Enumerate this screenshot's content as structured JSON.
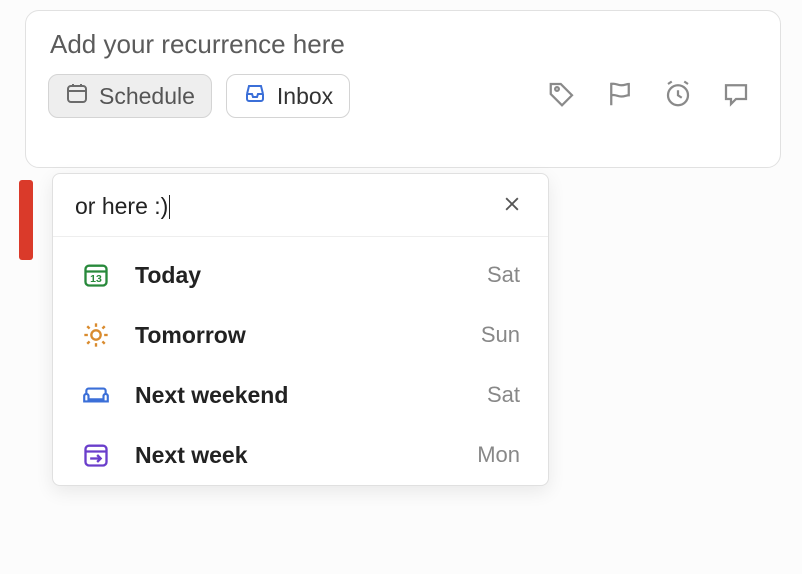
{
  "task": {
    "title_placeholder": "Add your recurrence here"
  },
  "chips": {
    "schedule": "Schedule",
    "inbox": "Inbox"
  },
  "dropdown": {
    "search_value": "or here :)",
    "items": [
      {
        "label": "Today",
        "day": "Sat",
        "icon": "calendar-13",
        "color": "#28893b"
      },
      {
        "label": "Tomorrow",
        "day": "Sun",
        "icon": "sun",
        "color": "#d98b2e"
      },
      {
        "label": "Next weekend",
        "day": "Sat",
        "icon": "couch",
        "color": "#3b6fd8"
      },
      {
        "label": "Next week",
        "day": "Mon",
        "icon": "arrow-right-box",
        "color": "#6a3ecb"
      }
    ]
  }
}
